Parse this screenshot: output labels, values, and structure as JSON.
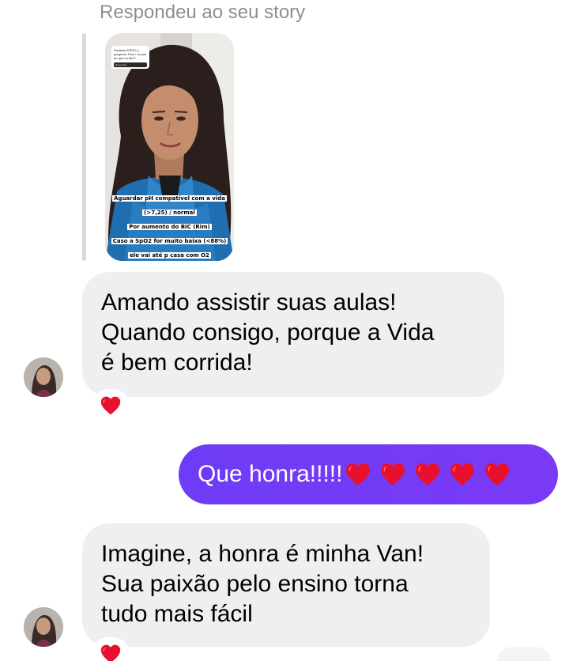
{
  "story_reply": {
    "label": "Respondeu ao seu story",
    "thumbnail": {
      "sticker_question": "Paciente DPOC p. pergunta: Fica + na pol do que no BiO?",
      "sticker_answer": "Responda...",
      "caption_lines": [
        "Aguardar  pH compatível com a vida (>7,25) / normal",
        "Por aumento do BIC (Rim)",
        "Caso a SpO2 for muito baixa (<88%)",
        "ele vai até p casa com O2"
      ]
    }
  },
  "messages": [
    {
      "direction": "incoming",
      "lines": [
        "Amando assistir suas aulas!",
        "Quando consigo, porque a Vida",
        "é bem corrida!"
      ],
      "reaction": "red-heart-emoji"
    },
    {
      "direction": "outgoing",
      "text": "Que honra!!!!!",
      "hearts": 5,
      "emoji": "red-heart-emoji"
    },
    {
      "direction": "incoming",
      "lines": [
        "Imagine, a honra é minha Van!",
        "Sua paixão pelo ensino torna",
        "tudo mais fácil"
      ],
      "reaction": "red-heart-emoji"
    }
  ],
  "colors": {
    "incoming_bubble": "#efeff2",
    "outgoing_bubble": "#7b3cf5",
    "heart": "#e8112d",
    "label": "#8e8e93"
  }
}
